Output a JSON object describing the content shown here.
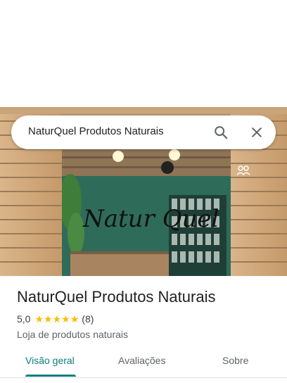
{
  "search": {
    "query": "NaturQuel Produtos Naturais"
  },
  "icons": {
    "search": "search-icon",
    "close": "close-icon",
    "photo_badge": "photo-badge-icon"
  },
  "place": {
    "name": "NaturQuel Produtos Naturais",
    "rating": "5,0",
    "stars": 5,
    "reviews": "(8)",
    "category": "Loja de produtos naturais",
    "wall_sign": "Natur Quel"
  },
  "tabs": [
    {
      "label": "Visão geral",
      "active": true
    },
    {
      "label": "Avaliações",
      "active": false
    },
    {
      "label": "Sobre",
      "active": false
    }
  ],
  "colors": {
    "accent": "#0b7e7a",
    "star": "#fbbc04",
    "wall": "#2f6b59"
  }
}
